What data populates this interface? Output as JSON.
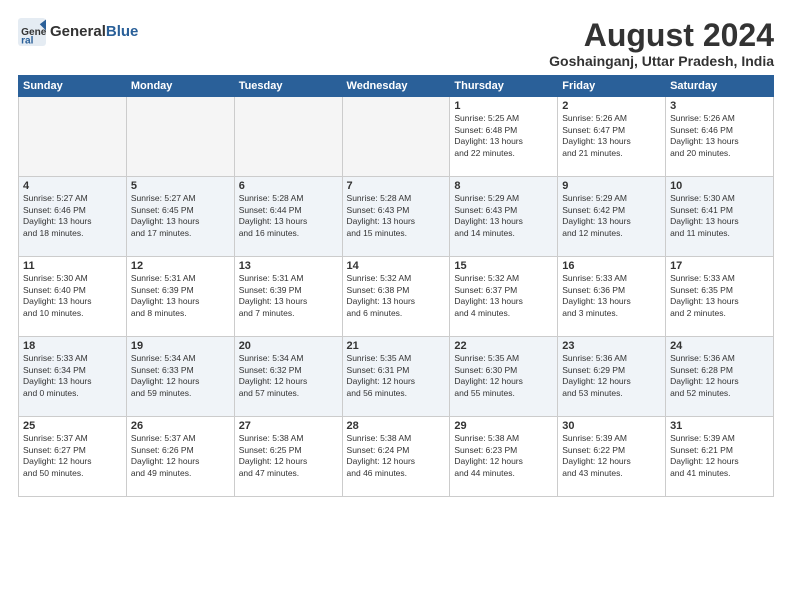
{
  "header": {
    "logo_general": "General",
    "logo_blue": "Blue",
    "title": "August 2024",
    "subtitle": "Goshainganj, Uttar Pradesh, India"
  },
  "calendar": {
    "days_of_week": [
      "Sunday",
      "Monday",
      "Tuesday",
      "Wednesday",
      "Thursday",
      "Friday",
      "Saturday"
    ],
    "weeks": [
      [
        {
          "day": "",
          "detail": ""
        },
        {
          "day": "",
          "detail": ""
        },
        {
          "day": "",
          "detail": ""
        },
        {
          "day": "",
          "detail": ""
        },
        {
          "day": "1",
          "detail": "Sunrise: 5:25 AM\nSunset: 6:48 PM\nDaylight: 13 hours\nand 22 minutes."
        },
        {
          "day": "2",
          "detail": "Sunrise: 5:26 AM\nSunset: 6:47 PM\nDaylight: 13 hours\nand 21 minutes."
        },
        {
          "day": "3",
          "detail": "Sunrise: 5:26 AM\nSunset: 6:46 PM\nDaylight: 13 hours\nand 20 minutes."
        }
      ],
      [
        {
          "day": "4",
          "detail": "Sunrise: 5:27 AM\nSunset: 6:46 PM\nDaylight: 13 hours\nand 18 minutes."
        },
        {
          "day": "5",
          "detail": "Sunrise: 5:27 AM\nSunset: 6:45 PM\nDaylight: 13 hours\nand 17 minutes."
        },
        {
          "day": "6",
          "detail": "Sunrise: 5:28 AM\nSunset: 6:44 PM\nDaylight: 13 hours\nand 16 minutes."
        },
        {
          "day": "7",
          "detail": "Sunrise: 5:28 AM\nSunset: 6:43 PM\nDaylight: 13 hours\nand 15 minutes."
        },
        {
          "day": "8",
          "detail": "Sunrise: 5:29 AM\nSunset: 6:43 PM\nDaylight: 13 hours\nand 14 minutes."
        },
        {
          "day": "9",
          "detail": "Sunrise: 5:29 AM\nSunset: 6:42 PM\nDaylight: 13 hours\nand 12 minutes."
        },
        {
          "day": "10",
          "detail": "Sunrise: 5:30 AM\nSunset: 6:41 PM\nDaylight: 13 hours\nand 11 minutes."
        }
      ],
      [
        {
          "day": "11",
          "detail": "Sunrise: 5:30 AM\nSunset: 6:40 PM\nDaylight: 13 hours\nand 10 minutes."
        },
        {
          "day": "12",
          "detail": "Sunrise: 5:31 AM\nSunset: 6:39 PM\nDaylight: 13 hours\nand 8 minutes."
        },
        {
          "day": "13",
          "detail": "Sunrise: 5:31 AM\nSunset: 6:39 PM\nDaylight: 13 hours\nand 7 minutes."
        },
        {
          "day": "14",
          "detail": "Sunrise: 5:32 AM\nSunset: 6:38 PM\nDaylight: 13 hours\nand 6 minutes."
        },
        {
          "day": "15",
          "detail": "Sunrise: 5:32 AM\nSunset: 6:37 PM\nDaylight: 13 hours\nand 4 minutes."
        },
        {
          "day": "16",
          "detail": "Sunrise: 5:33 AM\nSunset: 6:36 PM\nDaylight: 13 hours\nand 3 minutes."
        },
        {
          "day": "17",
          "detail": "Sunrise: 5:33 AM\nSunset: 6:35 PM\nDaylight: 13 hours\nand 2 minutes."
        }
      ],
      [
        {
          "day": "18",
          "detail": "Sunrise: 5:33 AM\nSunset: 6:34 PM\nDaylight: 13 hours\nand 0 minutes."
        },
        {
          "day": "19",
          "detail": "Sunrise: 5:34 AM\nSunset: 6:33 PM\nDaylight: 12 hours\nand 59 minutes."
        },
        {
          "day": "20",
          "detail": "Sunrise: 5:34 AM\nSunset: 6:32 PM\nDaylight: 12 hours\nand 57 minutes."
        },
        {
          "day": "21",
          "detail": "Sunrise: 5:35 AM\nSunset: 6:31 PM\nDaylight: 12 hours\nand 56 minutes."
        },
        {
          "day": "22",
          "detail": "Sunrise: 5:35 AM\nSunset: 6:30 PM\nDaylight: 12 hours\nand 55 minutes."
        },
        {
          "day": "23",
          "detail": "Sunrise: 5:36 AM\nSunset: 6:29 PM\nDaylight: 12 hours\nand 53 minutes."
        },
        {
          "day": "24",
          "detail": "Sunrise: 5:36 AM\nSunset: 6:28 PM\nDaylight: 12 hours\nand 52 minutes."
        }
      ],
      [
        {
          "day": "25",
          "detail": "Sunrise: 5:37 AM\nSunset: 6:27 PM\nDaylight: 12 hours\nand 50 minutes."
        },
        {
          "day": "26",
          "detail": "Sunrise: 5:37 AM\nSunset: 6:26 PM\nDaylight: 12 hours\nand 49 minutes."
        },
        {
          "day": "27",
          "detail": "Sunrise: 5:38 AM\nSunset: 6:25 PM\nDaylight: 12 hours\nand 47 minutes."
        },
        {
          "day": "28",
          "detail": "Sunrise: 5:38 AM\nSunset: 6:24 PM\nDaylight: 12 hours\nand 46 minutes."
        },
        {
          "day": "29",
          "detail": "Sunrise: 5:38 AM\nSunset: 6:23 PM\nDaylight: 12 hours\nand 44 minutes."
        },
        {
          "day": "30",
          "detail": "Sunrise: 5:39 AM\nSunset: 6:22 PM\nDaylight: 12 hours\nand 43 minutes."
        },
        {
          "day": "31",
          "detail": "Sunrise: 5:39 AM\nSunset: 6:21 PM\nDaylight: 12 hours\nand 41 minutes."
        }
      ]
    ]
  }
}
